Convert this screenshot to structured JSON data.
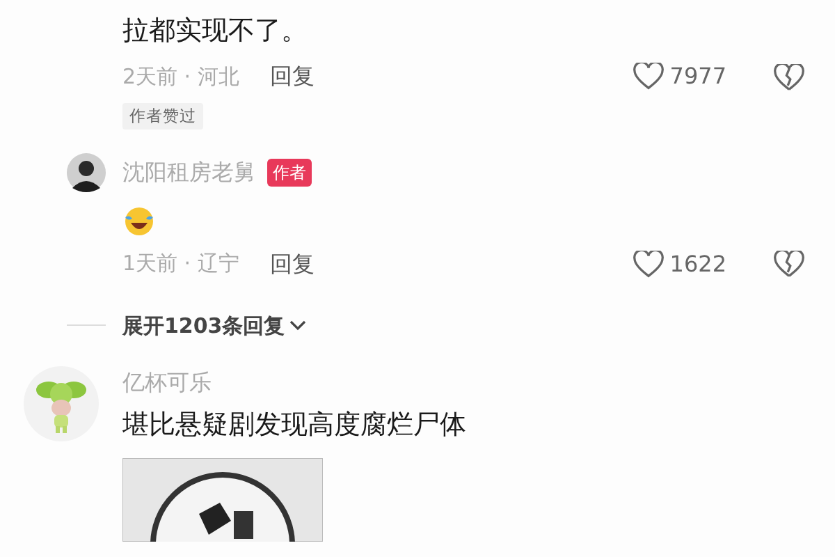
{
  "comments": [
    {
      "text": "拉都实现不了。",
      "time_location": "2天前 · 河北",
      "reply_label": "回复",
      "likes": "7977",
      "tag": "作者赞过",
      "replies": [
        {
          "avatar": {
            "kind": "person"
          },
          "author": "沈阳租房老舅",
          "author_badge": "作者",
          "content": {
            "kind": "emoji"
          },
          "time_location": "1天前 · 辽宁",
          "reply_label": "回复",
          "likes": "1622"
        }
      ],
      "expand_label": "展开1203条回复"
    },
    {
      "author": "亿杯可乐",
      "text": "堪比悬疑剧发现高度腐烂尸体"
    }
  ]
}
